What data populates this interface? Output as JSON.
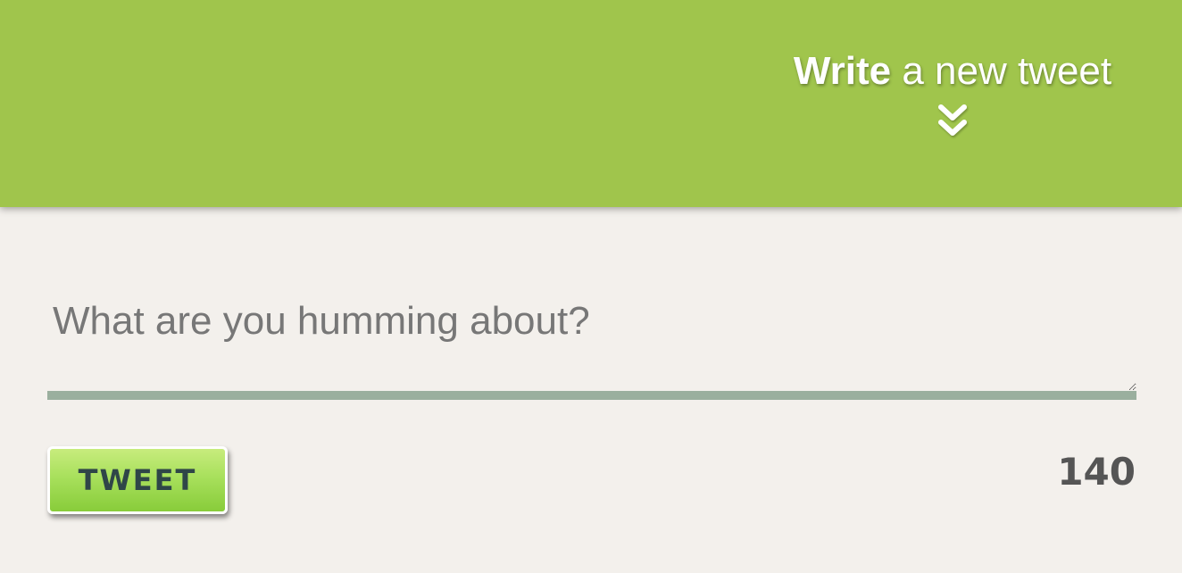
{
  "header": {
    "title_strong": "Write",
    "title_rest": " a new tweet",
    "toggle_icon": "double-chevron-down-icon",
    "background_color": "#a0c54c"
  },
  "compose": {
    "placeholder": "What are you humming about?",
    "value": "",
    "button_label": "TWEET",
    "char_count": "140",
    "background_color": "#f3f0ec",
    "button_color": "#a8e05c"
  }
}
